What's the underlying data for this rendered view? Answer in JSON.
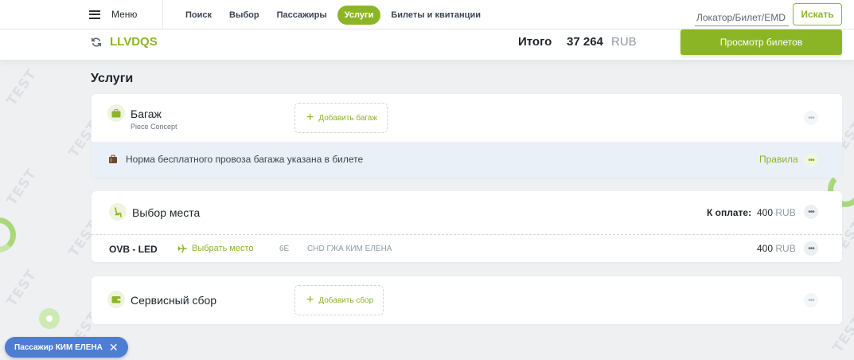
{
  "watermark": "TEST",
  "colors": {
    "accent": "#8cb526",
    "chip": "#4e7ed3",
    "note_bg": "#eaf0f8"
  },
  "topbar": {
    "menu_label": "Меню",
    "nav": [
      "Поиск",
      "Выбор",
      "Пассажиры",
      "Услуги",
      "Билеты и квитанции"
    ],
    "active_nav": "Услуги",
    "search_placeholder": "Локатор/Билет/EMD",
    "search_button": "Искать"
  },
  "subbar": {
    "locator": "LLVDQS",
    "total_label": "Итого",
    "total_value": "37 264",
    "total_currency": "RUB",
    "view_tickets_button": "Просмотр билетов"
  },
  "section_title": "Услуги",
  "baggage": {
    "icon": "suitcase-icon",
    "title": "Багаж",
    "subtitle": "Piece Concept",
    "add_button": "Добавить багаж",
    "note_icon": "luggage-icon",
    "note": "Норма бесплатного провоза багажа указана в билете",
    "rules_link": "Правила"
  },
  "seats": {
    "icon": "seat-icon",
    "title": "Выбор места",
    "pay_label": "К оплате:",
    "pay_value": "400",
    "pay_currency": "RUB",
    "row": {
      "route": "OVB - LED",
      "choose_seat": "Выбрать место",
      "seat": "6E",
      "passenger": "CHD ГЖА КИМ ЕЛЕНА",
      "price": "400",
      "currency": "RUB"
    }
  },
  "service_fee": {
    "icon": "wallet-icon",
    "title": "Сервисный сбор",
    "add_button": "Добавить сбор"
  },
  "passenger_chip": {
    "label": "Пассажир",
    "name": "КИМ ЕЛЕНА"
  }
}
